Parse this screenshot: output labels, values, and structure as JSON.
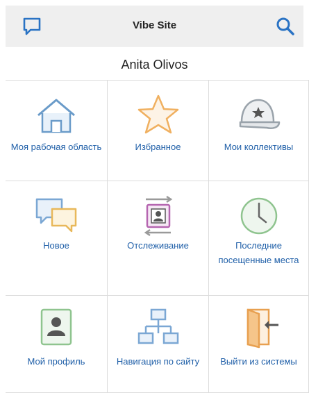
{
  "header": {
    "title": "Vibe Site",
    "left_icon": "chat-bubble-icon",
    "right_icon": "search-icon"
  },
  "user": {
    "name": "Anita Olivos"
  },
  "tiles": [
    {
      "id": "workspace",
      "label": "Моя рабочая область",
      "icon": "home-icon"
    },
    {
      "id": "favorites",
      "label": "Избранное",
      "icon": "star-icon"
    },
    {
      "id": "teams",
      "label": "Мои коллективы",
      "icon": "team-cap-icon"
    },
    {
      "id": "new",
      "label": "Новое",
      "icon": "chat-bubbles-icon"
    },
    {
      "id": "tracking",
      "label": "Отслеживание",
      "icon": "tracking-icon"
    },
    {
      "id": "recent",
      "label": "Последние посещенные места",
      "icon": "clock-icon"
    },
    {
      "id": "profile",
      "label": "Мой профиль",
      "icon": "profile-card-icon"
    },
    {
      "id": "sitemap",
      "label": "Навигация по сайту",
      "icon": "sitemap-icon"
    },
    {
      "id": "logout",
      "label": "Выйти из системы",
      "icon": "logout-door-icon"
    }
  ],
  "colors": {
    "label": "#1f5fa8",
    "header_bg": "#efefef",
    "grid_line": "#dcdcdc"
  }
}
